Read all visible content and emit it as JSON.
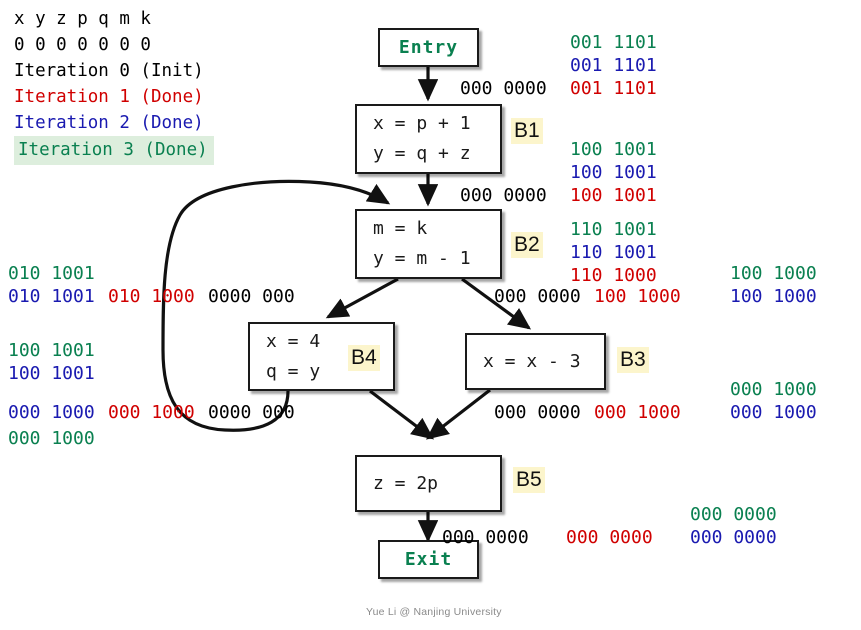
{
  "legend": {
    "vars_header": "x y z p q m k",
    "vars_values": "0 0 0 0 0 0 0",
    "iterations": [
      {
        "label": "Iteration 0 (Init)",
        "color": "#000000",
        "highlight": false
      },
      {
        "label": "Iteration 1 (Done)",
        "color": "#d00000",
        "highlight": false
      },
      {
        "label": "Iteration 2 (Done)",
        "color": "#1a1ab0",
        "highlight": false
      },
      {
        "label": "Iteration 3 (Done)",
        "color": "#0a8050",
        "highlight": true
      }
    ]
  },
  "nodes": {
    "entry": {
      "text": "Entry"
    },
    "exit": {
      "text": "Exit"
    },
    "b1": {
      "tag": "B1",
      "line1": "x = p + 1",
      "line2": "y = q + z"
    },
    "b2": {
      "tag": "B2",
      "line1": "m = k",
      "line2": "y = m - 1"
    },
    "b4": {
      "tag": "B4",
      "line1": "x = 4",
      "line2": "q = y"
    },
    "b3": {
      "tag": "B3",
      "line1": "x = x - 3"
    },
    "b5": {
      "tag": "B5",
      "line1": "z = 2p"
    }
  },
  "facts": {
    "entry_out_green": "001 1101",
    "entry_out_blue": "001 1101",
    "entry_out_black": "000 0000",
    "entry_out_red": "001 1101",
    "b1_out_green": "100 1001",
    "b1_out_blue": "100 1001",
    "b1_out_black": "000 0000",
    "b1_out_red": "100 1001",
    "b2_in_green": "110 1001",
    "b2_in_blue": "110 1001",
    "b2_in_red": "110 1000",
    "b2_to_b4_green": "010 1001",
    "b2_to_b4_blue": "010 1001",
    "b2_to_b4_red": "010 1000",
    "b2_to_b4_black": "0000 000",
    "b2_to_b3_black": "000 0000",
    "b2_to_b3_red": "100 1000",
    "b3_in_green": "100 1000",
    "b3_in_blue": "100 1000",
    "b4_in_green": "100 1001",
    "b4_in_blue": "100 1001",
    "b4_out_blue": "000 1000",
    "b4_out_red": "000 1000",
    "b4_out_black": "0000 000",
    "b4_out_green": "000 1000",
    "b3_out_black": "000 0000",
    "b3_out_red": "000 1000",
    "b3_out_green": "000 1000",
    "b3_out_blue": "000 1000",
    "b5_out_black": "000 0000",
    "b5_out_red": "000 0000",
    "b5_out_green": "000 0000",
    "b5_out_blue": "000 0000"
  },
  "footer": {
    "credit": "Yue Li @ Nanjing University"
  },
  "colors": {
    "black": "#000000",
    "red": "#d00000",
    "blue": "#1a1ab0",
    "green": "#0a8050",
    "tag_bg": "#fcf5cc",
    "highlight_bg": "#ddeedd"
  }
}
